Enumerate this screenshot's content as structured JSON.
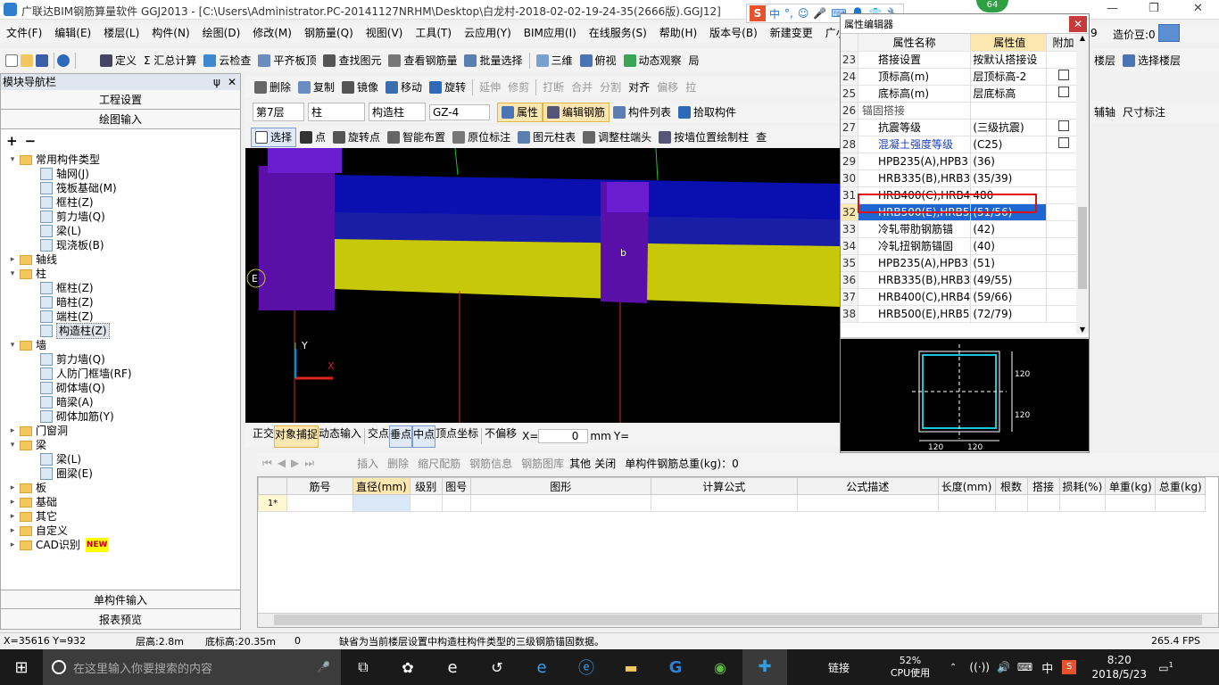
{
  "window": {
    "title": "广联达BIM钢筋算量软件 GGJ2013 - [C:\\Users\\Administrator.PC-20141127NRHM\\Desktop\\白龙村-2018-02-02-19-24-35(2666版).GGJ12]",
    "badge": "64",
    "min": "—",
    "max": "❐",
    "close": "✕"
  },
  "ime": {
    "logo": "S",
    "items": [
      "中",
      "°,",
      "☺",
      "🎤",
      "⌨",
      "👤",
      "👕",
      "🔧"
    ]
  },
  "menu": [
    "文件(F)",
    "编辑(E)",
    "楼层(L)",
    "构件(N)",
    "绘图(D)",
    "修改(M)",
    "钢筋量(Q)",
    "视图(V)",
    "工具(T)",
    "云应用(Y)",
    "BIM应用(I)",
    "在线服务(S)",
    "帮助(H)",
    "版本号(B)",
    "新建变更",
    "广小二"
  ],
  "menu_right": {
    "num": "9",
    "cost": "造价豆:0"
  },
  "toolbar1": [
    "定义",
    "Σ 汇总计算",
    "云检查",
    "平齐板顶",
    "查找图元",
    "查看钢筋量",
    "批量选择",
    "三维",
    "俯视",
    "动态观察",
    "局"
  ],
  "toolbar1_right": [
    "楼层",
    "选择楼层"
  ],
  "toolbar2": [
    "删除",
    "复制",
    "镜像",
    "移动",
    "旋转",
    "延伸",
    "修剪",
    "打断",
    "合并",
    "分割",
    "对齐",
    "偏移",
    "拉"
  ],
  "toolbar2_right": [
    "辅轴",
    "尺寸标注"
  ],
  "toolbar3": {
    "floor": "第7层",
    "type": "柱",
    "sub": "构造柱",
    "name": "GZ-4",
    "buttons": [
      "属性",
      "编辑钢筋",
      "构件列表",
      "拾取构件"
    ]
  },
  "toolbar4": [
    "选择",
    "点",
    "旋转点",
    "智能布置",
    "原位标注",
    "图元柱表",
    "调整柱端头",
    "按墙位置绘制柱",
    "查"
  ],
  "nav": {
    "title": "模块导航栏",
    "pin": "ψ",
    "close": "✕",
    "tab1": "工程设置",
    "tab2": "绘图输入",
    "bottom1": "单构件输入",
    "bottom2": "报表预览"
  },
  "tree": [
    {
      "lvl": 0,
      "exp": "▾",
      "label": "常用构件类型",
      "folder": true
    },
    {
      "lvl": 1,
      "label": "轴网(J)"
    },
    {
      "lvl": 1,
      "label": "筏板基础(M)"
    },
    {
      "lvl": 1,
      "label": "框柱(Z)"
    },
    {
      "lvl": 1,
      "label": "剪力墙(Q)"
    },
    {
      "lvl": 1,
      "label": "梁(L)"
    },
    {
      "lvl": 1,
      "label": "现浇板(B)"
    },
    {
      "lvl": 0,
      "exp": "▸",
      "label": "轴线",
      "folder": true
    },
    {
      "lvl": 0,
      "exp": "▾",
      "label": "柱",
      "folder": true
    },
    {
      "lvl": 1,
      "label": "框柱(Z)"
    },
    {
      "lvl": 1,
      "label": "暗柱(Z)"
    },
    {
      "lvl": 1,
      "label": "端柱(Z)"
    },
    {
      "lvl": 1,
      "label": "构造柱(Z)",
      "sel": true
    },
    {
      "lvl": 0,
      "exp": "▾",
      "label": "墙",
      "folder": true
    },
    {
      "lvl": 1,
      "label": "剪力墙(Q)"
    },
    {
      "lvl": 1,
      "label": "人防门框墙(RF)"
    },
    {
      "lvl": 1,
      "label": "砌体墙(Q)"
    },
    {
      "lvl": 1,
      "label": "暗梁(A)"
    },
    {
      "lvl": 1,
      "label": "砌体加筋(Y)"
    },
    {
      "lvl": 0,
      "exp": "▸",
      "label": "门窗洞",
      "folder": true
    },
    {
      "lvl": 0,
      "exp": "▾",
      "label": "梁",
      "folder": true
    },
    {
      "lvl": 1,
      "label": "梁(L)"
    },
    {
      "lvl": 1,
      "label": "圈梁(E)"
    },
    {
      "lvl": 0,
      "exp": "▸",
      "label": "板",
      "folder": true
    },
    {
      "lvl": 0,
      "exp": "▸",
      "label": "基础",
      "folder": true
    },
    {
      "lvl": 0,
      "exp": "▸",
      "label": "其它",
      "folder": true
    },
    {
      "lvl": 0,
      "exp": "▸",
      "label": "自定义",
      "folder": true
    },
    {
      "lvl": 0,
      "exp": "▸",
      "label": "CAD识别",
      "folder": true,
      "badge": "NEW"
    }
  ],
  "canvas": {
    "label_b": "b",
    "axis_y": "Y",
    "axis_x": "X",
    "label_e": "E"
  },
  "snapbar": {
    "items": [
      "正交",
      "对象捕捉",
      "动态输入",
      "交点",
      "垂点",
      "中点",
      "顶点",
      "坐标",
      "不偏移"
    ],
    "x_label": "X=",
    "x_value": "0",
    "unit": "mm",
    "y_label": "Y="
  },
  "gridtb": {
    "items": [
      "插入",
      "删除",
      "缩尺配筋",
      "钢筋信息",
      "钢筋图库",
      "其他",
      "关闭"
    ],
    "total_label": "单构件钢筋总重(kg)：0"
  },
  "grid": {
    "headers": [
      "筋号",
      "直径(mm)",
      "级别",
      "图号",
      "图形",
      "计算公式",
      "公式描述",
      "长度(mm)",
      "根数",
      "搭接",
      "损耗(%)",
      "单重(kg)",
      "总重(kg)"
    ],
    "row_label": "1*"
  },
  "prop": {
    "title": "属性编辑器",
    "col_name": "属性名称",
    "col_value": "属性值",
    "col_add": "附加",
    "rows": [
      {
        "n": "23",
        "name": "搭接设置",
        "value": "按默认搭接设",
        "chk": false
      },
      {
        "n": "24",
        "name": "顶标高(m)",
        "value": "层顶标高-2",
        "chk": true
      },
      {
        "n": "25",
        "name": "底标高(m)",
        "value": "层底标高",
        "chk": true
      },
      {
        "n": "26",
        "name": "锚固搭接",
        "value": "",
        "group": true
      },
      {
        "n": "27",
        "name": "抗震等级",
        "value": "(三级抗震)",
        "chk": true
      },
      {
        "n": "28",
        "name": "混凝土强度等级",
        "value": "(C25)",
        "chk": true,
        "blue": true
      },
      {
        "n": "29",
        "name": "HPB235(A),HPB3",
        "value": "(36)"
      },
      {
        "n": "30",
        "name": "HRB335(B),HRB3",
        "value": "(35/39)"
      },
      {
        "n": "31",
        "name": "HRB400(C),HRB4",
        "value": "480",
        "highlight": true
      },
      {
        "n": "32",
        "name": "HRB500(E),HRB5",
        "value": "(51/56)",
        "selected": true
      },
      {
        "n": "33",
        "name": "冷轧带肋钢筋锚",
        "value": "(42)"
      },
      {
        "n": "34",
        "name": "冷轧扭钢筋锚固",
        "value": "(40)"
      },
      {
        "n": "35",
        "name": "HPB235(A),HPB3",
        "value": "(51)"
      },
      {
        "n": "36",
        "name": "HRB335(B),HRB3",
        "value": "(49/55)"
      },
      {
        "n": "37",
        "name": "HRB400(C),HRB4",
        "value": "(59/66)"
      },
      {
        "n": "38",
        "name": "HRB500(E),HRB5",
        "value": "(72/79)"
      }
    ],
    "dims": [
      "120",
      "120",
      "120",
      "120"
    ]
  },
  "status": {
    "coords": "X=35616 Y=932",
    "floor_h": "层高:2.8m",
    "base_h": "底标高:20.35m",
    "zero": "0",
    "msg": "缺省为当前楼层设置中构造柱构件类型的三级钢筋锚固数据。",
    "fps": "265.4 FPS"
  },
  "taskbar": {
    "search": "在这里输入你要搜索的内容",
    "link": "链接",
    "cpu_pct": "52%",
    "cpu_label": "CPU使用",
    "ime": "中",
    "time": "8:20",
    "date": "2018/5/23",
    "notif": "1"
  }
}
